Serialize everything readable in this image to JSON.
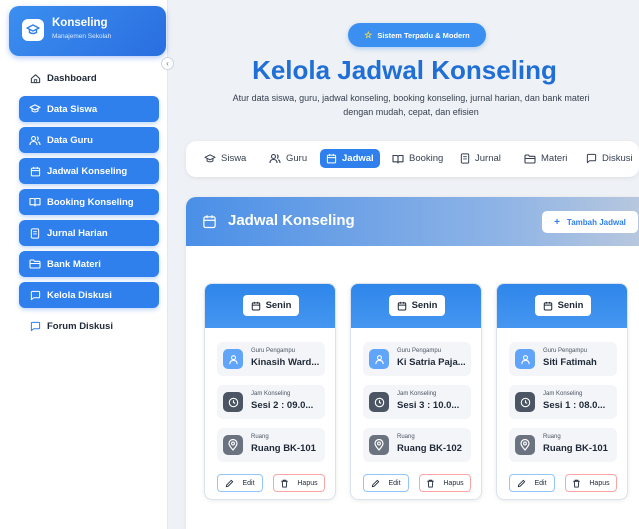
{
  "brand": {
    "title": "Konseling",
    "subtitle": "Manajemen Sekolah"
  },
  "sidebar": {
    "items": [
      {
        "label": "Dashboard",
        "icon": "home-icon",
        "active": false
      },
      {
        "label": "Data Siswa",
        "icon": "graduation-cap-icon",
        "active": true
      },
      {
        "label": "Data Guru",
        "icon": "users-icon",
        "active": true
      },
      {
        "label": "Jadwal Konseling",
        "icon": "calendar-icon",
        "active": true
      },
      {
        "label": "Booking Konseling",
        "icon": "book-open-icon",
        "active": true
      },
      {
        "label": "Jurnal Harian",
        "icon": "journal-icon",
        "active": true
      },
      {
        "label": "Bank Materi",
        "icon": "folder-icon",
        "active": true
      },
      {
        "label": "Kelola Diskusi",
        "icon": "chat-icon",
        "active": true
      },
      {
        "label": "Forum Diskusi",
        "icon": "chat-icon",
        "active": false
      }
    ]
  },
  "hero": {
    "badge": "Sistem Terpadu & Modern",
    "title": "Kelola Jadwal Konseling",
    "description": "Atur data siswa, guru, jadwal konseling, booking konseling, jurnal harian, dan bank materi dengan mudah, cepat, dan efisien"
  },
  "tabs": [
    {
      "label": "Siswa",
      "icon": "graduation-cap-icon"
    },
    {
      "label": "Guru",
      "icon": "users-icon"
    },
    {
      "label": "Jadwal",
      "icon": "calendar-icon",
      "active": true
    },
    {
      "label": "Booking",
      "icon": "book-open-icon"
    },
    {
      "label": "Jurnal",
      "icon": "journal-icon"
    },
    {
      "label": "Materi",
      "icon": "folder-icon"
    },
    {
      "label": "Diskusi",
      "icon": "chat-icon"
    }
  ],
  "panel": {
    "title": "Jadwal Konseling",
    "add_label": "Tambah Jadwal"
  },
  "labels": {
    "guru": "Guru Pengampu",
    "jam": "Jam Konseling",
    "ruang": "Ruang",
    "edit": "Edit",
    "hapus": "Hapus"
  },
  "cards": [
    {
      "day": "Senin",
      "guru": "Kinasih Ward...",
      "jam": "Sesi 2 : 09.0...",
      "ruang": "Ruang BK-101"
    },
    {
      "day": "Senin",
      "guru": "Ki Satria Paja...",
      "jam": "Sesi 3 : 10.0...",
      "ruang": "Ruang BK-102"
    },
    {
      "day": "Senin",
      "guru": "Siti Fatimah",
      "jam": "Sesi 1 : 08.0...",
      "ruang": "Ruang BK-101"
    }
  ],
  "colors": {
    "primary": "#2f80ed",
    "title": "#1f6fd6",
    "guru_icon": "#60a5fa",
    "jam_icon": "#4b5563",
    "ruang_icon": "#6b7280"
  }
}
